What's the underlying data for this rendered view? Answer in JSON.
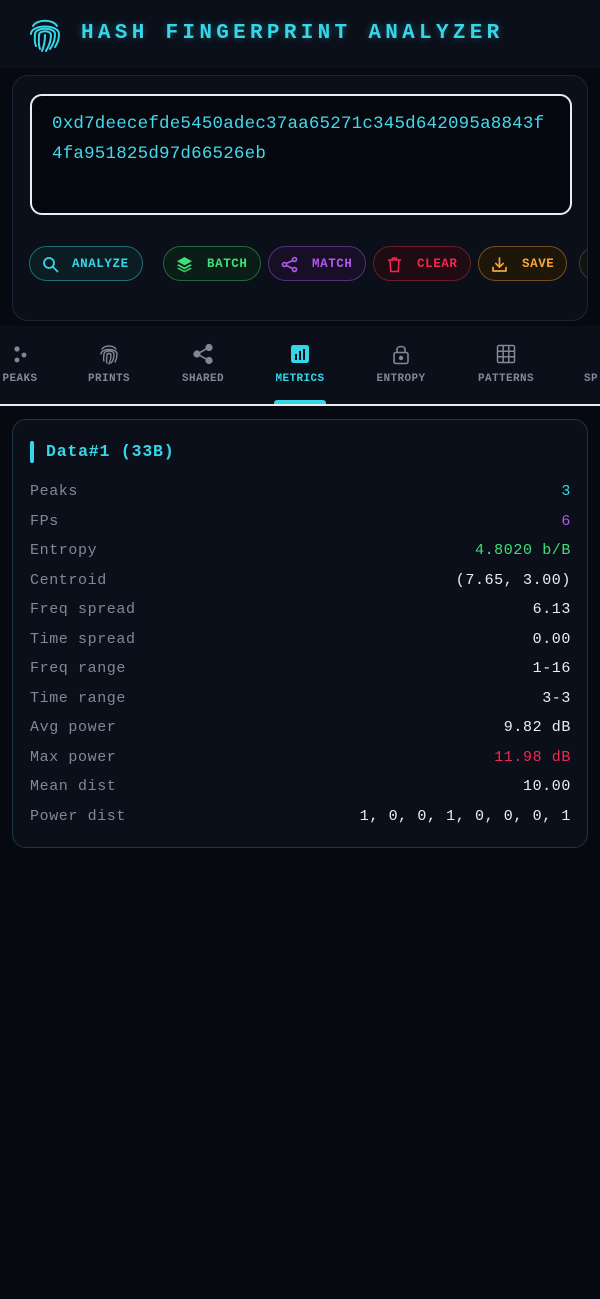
{
  "app": {
    "title": "HASH FINGERPRINT ANALYZER",
    "logo_icon": "fingerprint-icon",
    "accent": "#35d6e8"
  },
  "input": {
    "value": "0xd7deecefde5450adec37aa65271c345d642095a8843f4fa951825d97d66526eb"
  },
  "actions": [
    {
      "label": "ANALYZE",
      "icon": "search-icon",
      "color": "#35d6e8"
    },
    {
      "label": "BATCH",
      "icon": "layers-icon",
      "color": "#3ee07a"
    },
    {
      "label": "MATCH",
      "icon": "share-icon",
      "color": "#b058f0"
    },
    {
      "label": "CLEAR",
      "icon": "trash-icon",
      "color": "#f0284f"
    },
    {
      "label": "SAVE",
      "icon": "download-icon",
      "color": "#f5a53a"
    }
  ],
  "tabs": [
    {
      "label": "PEAKS",
      "icon": "scatter-icon",
      "active": false
    },
    {
      "label": "PRINTS",
      "icon": "fingerprint-icon",
      "active": false
    },
    {
      "label": "SHARED",
      "icon": "share-icon",
      "active": false
    },
    {
      "label": "METRICS",
      "icon": "bar-chart-icon",
      "active": true
    },
    {
      "label": "ENTROPY",
      "icon": "lock-icon",
      "active": false
    },
    {
      "label": "PATTERNS",
      "icon": "grid-icon",
      "active": false
    },
    {
      "label": "SP",
      "icon": "",
      "active": false
    }
  ],
  "metrics": {
    "title": "Data#1 (33B)",
    "rows": [
      {
        "label": "Peaks",
        "value": "3",
        "color": "#35d6e8"
      },
      {
        "label": "FPs",
        "value": "6",
        "color": "#b058f0"
      },
      {
        "label": "Entropy",
        "value": "4.8020 b/B",
        "color": "#3ee07a"
      },
      {
        "label": "Centroid",
        "value": "(7.65, 3.00)",
        "color": "#e9eef4"
      },
      {
        "label": "Freq spread",
        "value": "6.13",
        "color": "#e9eef4"
      },
      {
        "label": "Time spread",
        "value": "0.00",
        "color": "#e9eef4"
      },
      {
        "label": "Freq range",
        "value": "1-16",
        "color": "#e9eef4"
      },
      {
        "label": "Time range",
        "value": "3-3",
        "color": "#e9eef4"
      },
      {
        "label": "Avg power",
        "value": "9.82 dB",
        "color": "#e9eef4"
      },
      {
        "label": "Max power",
        "value": "11.98 dB",
        "color": "#f0284f"
      },
      {
        "label": "Mean dist",
        "value": "10.00",
        "color": "#e9eef4"
      },
      {
        "label": "Power dist",
        "value": "1, 0, 0, 1, 0, 0, 0, 1",
        "color": "#e9eef4"
      }
    ]
  }
}
